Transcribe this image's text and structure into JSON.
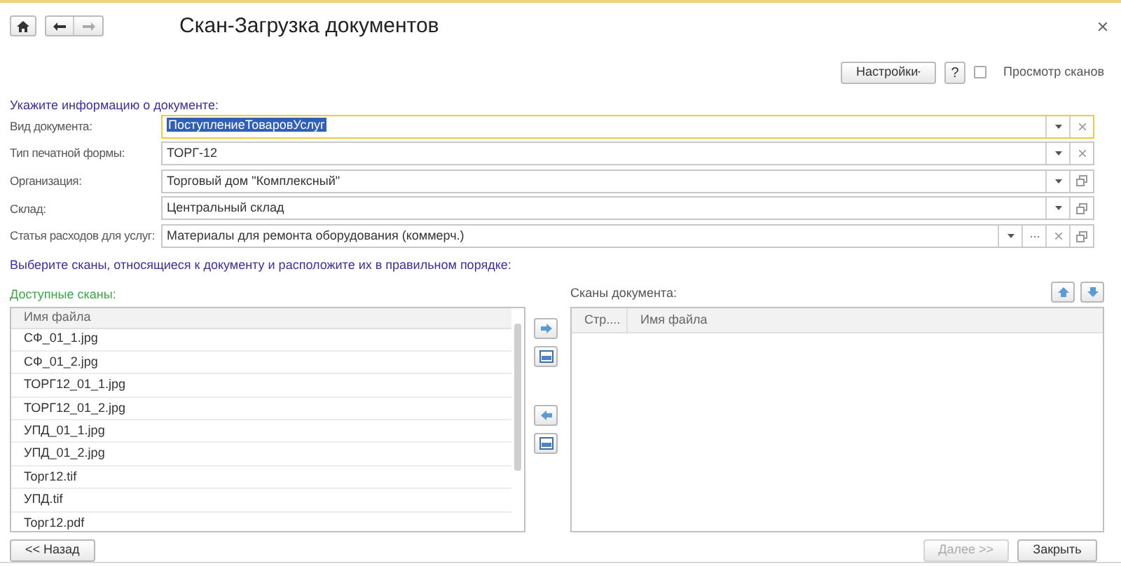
{
  "window": {
    "title": "Скан-Загрузка документов"
  },
  "toolbar": {
    "settings": "Настройки",
    "help": "?",
    "preview": {
      "label": "Просмотр сканов",
      "checked": false
    }
  },
  "document_info": {
    "heading": "Укажите информацию о документе:",
    "fields": [
      {
        "label": "Вид документа:",
        "value": "ПоступлениеТоваровУслуг",
        "focused": true,
        "buttons": [
          {
            "kind": "dropdown"
          },
          {
            "kind": "clear"
          }
        ]
      },
      {
        "label": "Тип печатной формы:",
        "value": "ТОРГ-12",
        "focused": false,
        "buttons": [
          {
            "kind": "dropdown"
          },
          {
            "kind": "clear"
          }
        ]
      },
      {
        "label": "Организация:",
        "value": "Торговый дом \"Комплексный\"",
        "focused": false,
        "buttons": [
          {
            "kind": "dropdown"
          },
          {
            "kind": "open"
          }
        ]
      },
      {
        "label": "Склад:",
        "value": "Центральный склад",
        "focused": false,
        "buttons": [
          {
            "kind": "dropdown"
          },
          {
            "kind": "open"
          }
        ]
      },
      {
        "label": "Статья расходов для услуг:",
        "value": "Материалы для ремонта оборудования (коммерч.)",
        "focused": false,
        "buttons": [
          {
            "kind": "dropdown"
          },
          {
            "kind": "select"
          },
          {
            "kind": "clear"
          },
          {
            "kind": "open"
          }
        ]
      }
    ]
  },
  "scans_heading": "Выберите сканы, относящиеся к документу и расположите их в правильном порядке:",
  "available": {
    "label": "Доступные сканы:",
    "columns": [
      "Имя файла"
    ],
    "rows": [
      {
        "name": "СФ_01_1.jpg"
      },
      {
        "name": "СФ_01_2.jpg"
      },
      {
        "name": "ТОРГ12_01_1.jpg"
      },
      {
        "name": "ТОРГ12_01_2.jpg"
      },
      {
        "name": "УПД_01_1.jpg"
      },
      {
        "name": "УПД_01_2.jpg"
      },
      {
        "name": "Торг12.tif"
      },
      {
        "name": "УПД.tif"
      },
      {
        "name": "Торг12.pdf"
      }
    ]
  },
  "document_scans": {
    "label": "Сканы документа:",
    "columns": [
      "Стр....",
      "Имя файла"
    ]
  },
  "buttons": [
    {
      "label": "<< Назад",
      "disabled": false
    },
    {
      "label": "Далее >>",
      "disabled": true
    },
    {
      "label": "Закрыть",
      "disabled": false
    }
  ]
}
